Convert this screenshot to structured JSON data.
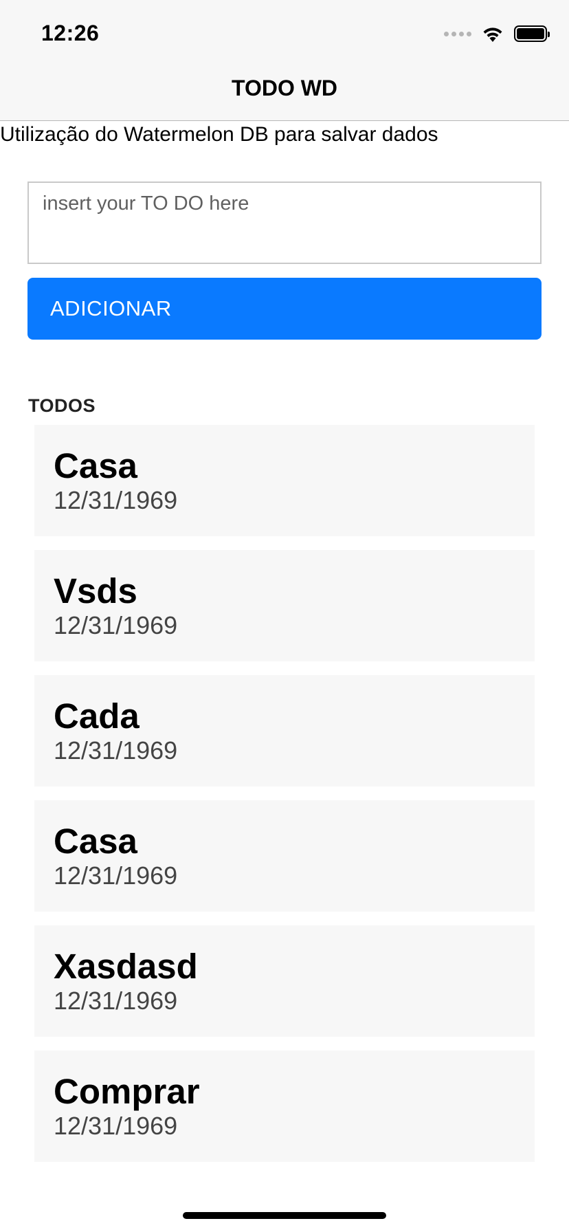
{
  "status_bar": {
    "time": "12:26"
  },
  "header": {
    "title": "TODO WD"
  },
  "subtitle": "Utilização do Watermelon DB para salvar dados",
  "input": {
    "placeholder": "insert your TO DO here",
    "value": ""
  },
  "add_button": {
    "label": "ADICIONAR"
  },
  "list": {
    "header": "TODOS",
    "items": [
      {
        "title": "Casa",
        "date": "12/31/1969"
      },
      {
        "title": "Vsds",
        "date": "12/31/1969"
      },
      {
        "title": "Cada",
        "date": "12/31/1969"
      },
      {
        "title": "Casa",
        "date": "12/31/1969"
      },
      {
        "title": "Xasdasd",
        "date": "12/31/1969"
      },
      {
        "title": "Comprar",
        "date": "12/31/1969"
      }
    ]
  },
  "colors": {
    "accent": "#0a7aff",
    "topbar_bg": "#f7f7f7",
    "item_bg": "#f7f7f7",
    "date_text": "#444444"
  },
  "icons": [
    "cellular-signal-icon",
    "wifi-icon",
    "battery-icon"
  ]
}
